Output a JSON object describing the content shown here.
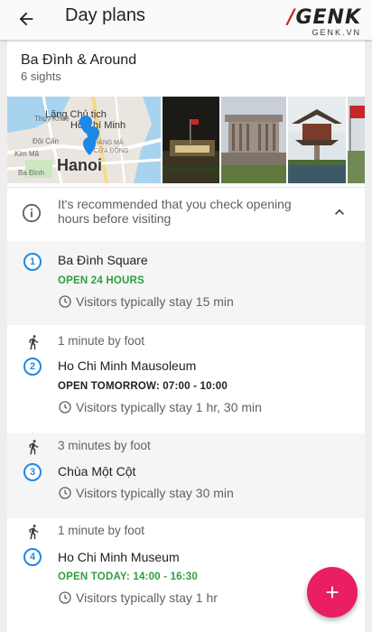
{
  "appbar": {
    "title": "Day plans",
    "back_icon": "arrow-back-icon"
  },
  "watermark": {
    "brand": "GENK",
    "sub": "GENK.VN"
  },
  "plan": {
    "name": "Ba Đình & Around",
    "sights": "6 sights"
  },
  "map": {
    "city": "Hanoi",
    "labels": [
      "Lăng Chủ tịch",
      "Hồ Chí Minh",
      "Thụy Khuê",
      "Đội Cấn",
      "Kim Mã",
      "Ba Đình",
      "HÀNG MÃ",
      "CỬA ĐÔNG"
    ]
  },
  "notice": {
    "text": "It's recommended that you check opening hours before visiting",
    "icon": "info-icon",
    "toggle_icon": "chevron-up-icon"
  },
  "stops": [
    {
      "num": "1",
      "name": "Ba Đình Square",
      "hours": "OPEN 24 HOURS",
      "hours_color": "green",
      "stay": "Visitors typically stay 15 min"
    },
    {
      "num": "2",
      "name": "Ho Chi Minh Mausoleum",
      "hours": "OPEN TOMORROW: 07:00 - 10:00",
      "hours_color": "dark",
      "stay": "Visitors typically stay 1 hr, 30 min"
    },
    {
      "num": "3",
      "name": "Chùa Một Cột",
      "hours": "",
      "stay": "Visitors typically stay 30 min"
    },
    {
      "num": "4",
      "name": "Ho Chi Minh Museum",
      "hours": "OPEN TODAY: 14:00 - 16:30",
      "hours_color": "green",
      "stay": "Visitors typically stay 1 hr"
    }
  ],
  "legs": [
    {
      "text": "1 minute by foot",
      "icon": "walk-icon"
    },
    {
      "text": "3 minutes by foot",
      "icon": "walk-icon"
    },
    {
      "text": "1 minute by foot",
      "icon": "walk-icon"
    }
  ],
  "fab": {
    "icon": "plus-icon"
  },
  "colors": {
    "accent": "#1e88e5",
    "open": "#2e9e3e",
    "fab": "#e91e63"
  }
}
